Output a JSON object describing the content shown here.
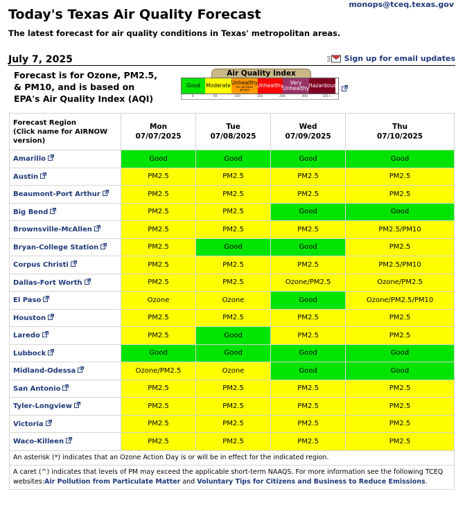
{
  "header": {
    "email": "monops@tceq.texas.gov",
    "title": "Today's Texas Air Quality Forecast",
    "subtitle": "The latest forecast for air quality conditions in Texas' metropolitan areas.",
    "date": "July 7, 2025",
    "signup": "Sign up for email updates"
  },
  "note": "Forecast is for Ozone, PM2.5, & PM10, and is based on EPA's Air Quality Index (AQI)",
  "aqi": {
    "title": "Air Quality Index",
    "categories": [
      "Good",
      "Moderate",
      "Unhealthy",
      "for sensitive groups",
      "Unhealthy",
      "Very Unhealthy",
      "Hazardous"
    ],
    "scale": [
      "0",
      "50",
      "100",
      "150",
      "200",
      "300",
      "301+"
    ],
    "colors": {
      "good": "#00e400",
      "moderate": "#ffff00",
      "usg": "#ff9900",
      "unhealthy": "#ff0000",
      "very_unhealthy": "#993366",
      "hazardous": "#7e0023"
    }
  },
  "table": {
    "region_header": "Forecast Region",
    "region_header_sub": "(Click name for AIRNOW version)",
    "days": [
      {
        "name": "Mon",
        "date": "07/07/2025"
      },
      {
        "name": "Tue",
        "date": "07/08/2025"
      },
      {
        "name": "Wed",
        "date": "07/09/2025"
      },
      {
        "name": "Thu",
        "date": "07/10/2025"
      }
    ],
    "rows": [
      {
        "region": "Amarillo",
        "cells": [
          {
            "t": "Good",
            "c": "good"
          },
          {
            "t": "Good",
            "c": "good"
          },
          {
            "t": "Good",
            "c": "good"
          },
          {
            "t": "Good",
            "c": "good"
          }
        ]
      },
      {
        "region": "Austin",
        "cells": [
          {
            "t": "PM2.5",
            "c": "mod"
          },
          {
            "t": "PM2.5",
            "c": "mod"
          },
          {
            "t": "PM2.5",
            "c": "mod"
          },
          {
            "t": "PM2.5",
            "c": "mod"
          }
        ]
      },
      {
        "region": "Beaumont-Port Arthur",
        "cells": [
          {
            "t": "PM2.5",
            "c": "mod"
          },
          {
            "t": "PM2.5",
            "c": "mod"
          },
          {
            "t": "PM2.5",
            "c": "mod"
          },
          {
            "t": "PM2.5",
            "c": "mod"
          }
        ]
      },
      {
        "region": "Big Bend",
        "cells": [
          {
            "t": "PM2.5",
            "c": "mod"
          },
          {
            "t": "PM2.5",
            "c": "mod"
          },
          {
            "t": "Good",
            "c": "good"
          },
          {
            "t": "Good",
            "c": "good"
          }
        ]
      },
      {
        "region": "Brownsville-McAllen",
        "cells": [
          {
            "t": "PM2.5",
            "c": "mod"
          },
          {
            "t": "PM2.5",
            "c": "mod"
          },
          {
            "t": "PM2.5",
            "c": "mod"
          },
          {
            "t": "PM2.5/PM10",
            "c": "mod"
          }
        ]
      },
      {
        "region": "Bryan-College Station",
        "cells": [
          {
            "t": "PM2.5",
            "c": "mod"
          },
          {
            "t": "Good",
            "c": "good"
          },
          {
            "t": "Good",
            "c": "good"
          },
          {
            "t": "PM2.5",
            "c": "mod"
          }
        ]
      },
      {
        "region": "Corpus Christi",
        "cells": [
          {
            "t": "PM2.5",
            "c": "mod"
          },
          {
            "t": "PM2.5",
            "c": "mod"
          },
          {
            "t": "PM2.5",
            "c": "mod"
          },
          {
            "t": "PM2.5/PM10",
            "c": "mod"
          }
        ]
      },
      {
        "region": "Dallas-Fort Worth",
        "cells": [
          {
            "t": "PM2.5",
            "c": "mod"
          },
          {
            "t": "PM2.5",
            "c": "mod"
          },
          {
            "t": "Ozone/PM2.5",
            "c": "mod"
          },
          {
            "t": "Ozone/PM2.5",
            "c": "mod"
          }
        ]
      },
      {
        "region": "El Paso",
        "cells": [
          {
            "t": "Ozone",
            "c": "mod"
          },
          {
            "t": "Ozone",
            "c": "mod"
          },
          {
            "t": "Good",
            "c": "good"
          },
          {
            "t": "Ozone/PM2.5/PM10",
            "c": "mod"
          }
        ]
      },
      {
        "region": "Houston",
        "cells": [
          {
            "t": "PM2.5",
            "c": "mod"
          },
          {
            "t": "PM2.5",
            "c": "mod"
          },
          {
            "t": "PM2.5",
            "c": "mod"
          },
          {
            "t": "PM2.5",
            "c": "mod"
          }
        ]
      },
      {
        "region": "Laredo",
        "cells": [
          {
            "t": "PM2.5",
            "c": "mod"
          },
          {
            "t": "Good",
            "c": "good"
          },
          {
            "t": "PM2.5",
            "c": "mod"
          },
          {
            "t": "PM2.5",
            "c": "mod"
          }
        ]
      },
      {
        "region": "Lubbock",
        "cells": [
          {
            "t": "Good",
            "c": "good"
          },
          {
            "t": "Good",
            "c": "good"
          },
          {
            "t": "Good",
            "c": "good"
          },
          {
            "t": "Good",
            "c": "good"
          }
        ]
      },
      {
        "region": "Midland-Odessa",
        "cells": [
          {
            "t": "Ozone/PM2.5",
            "c": "mod"
          },
          {
            "t": "Ozone",
            "c": "mod"
          },
          {
            "t": "Good",
            "c": "good"
          },
          {
            "t": "Good",
            "c": "good"
          }
        ]
      },
      {
        "region": "San Antonio",
        "cells": [
          {
            "t": "PM2.5",
            "c": "mod"
          },
          {
            "t": "PM2.5",
            "c": "mod"
          },
          {
            "t": "PM2.5",
            "c": "mod"
          },
          {
            "t": "PM2.5",
            "c": "mod"
          }
        ]
      },
      {
        "region": "Tyler-Longview",
        "cells": [
          {
            "t": "PM2.5",
            "c": "mod"
          },
          {
            "t": "PM2.5",
            "c": "mod"
          },
          {
            "t": "PM2.5",
            "c": "mod"
          },
          {
            "t": "PM2.5",
            "c": "mod"
          }
        ]
      },
      {
        "region": "Victoria",
        "cells": [
          {
            "t": "PM2.5",
            "c": "mod"
          },
          {
            "t": "PM2.5",
            "c": "mod"
          },
          {
            "t": "PM2.5",
            "c": "mod"
          },
          {
            "t": "PM2.5",
            "c": "mod"
          }
        ]
      },
      {
        "region": "Waco-Killeen",
        "cells": [
          {
            "t": "PM2.5",
            "c": "mod"
          },
          {
            "t": "PM2.5",
            "c": "mod"
          },
          {
            "t": "PM2.5",
            "c": "mod"
          },
          {
            "t": "PM2.5",
            "c": "mod"
          }
        ]
      }
    ]
  },
  "footer": {
    "asterisk": "An asterisk (*) indicates that an Ozone Action Day is or will be in effect for the indicated region.",
    "caret": "A caret (^) indicates that levels of PM may exceed the applicable short-term NAAQS. For more information see the following TCEQ websites:",
    "link1": "Air Pollution from Particulate Matter",
    "and": "and",
    "link2": "Voluntary Tips for Citizens and Business to Reduce Emissions",
    "end": "."
  }
}
